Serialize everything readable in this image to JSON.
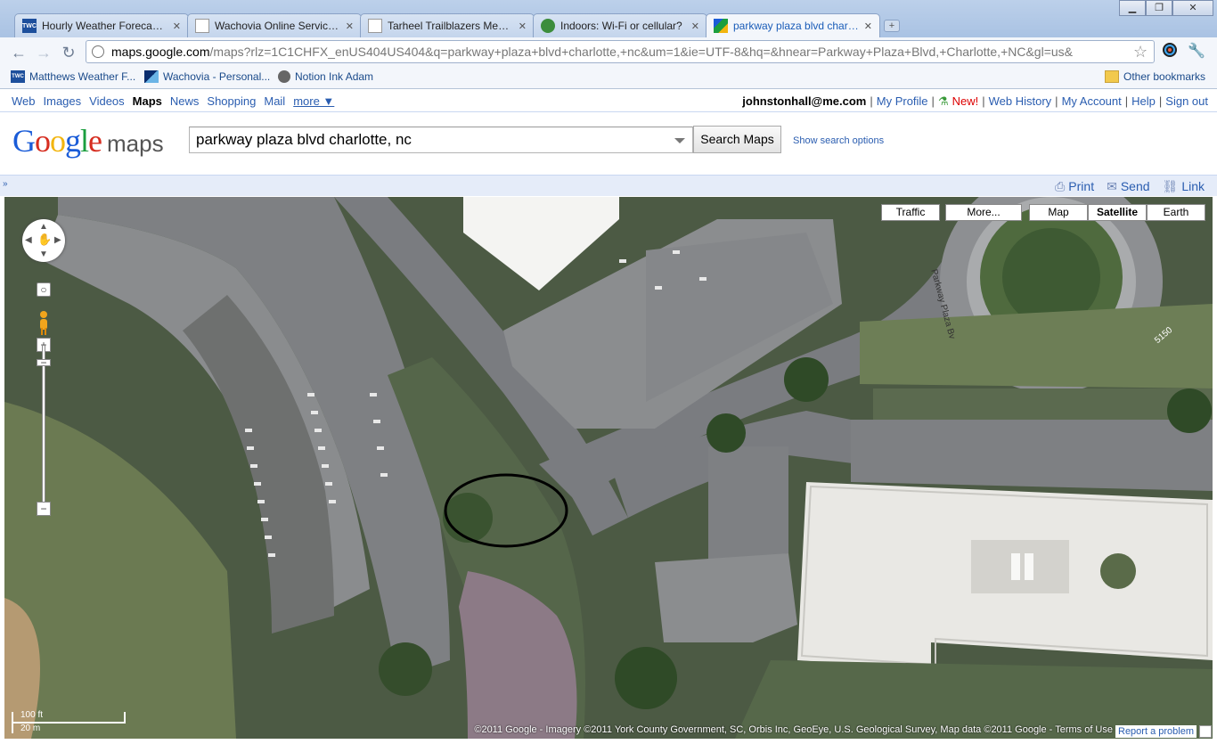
{
  "tabs": [
    {
      "label": "Hourly Weather Forecast ...",
      "icon": "twc-icon",
      "icon_text": "TWC"
    },
    {
      "label": "Wachovia Online Service...",
      "icon": "page-icon"
    },
    {
      "label": "Tarheel Trailblazers Mess...",
      "icon": "page-icon"
    },
    {
      "label": "Indoors: Wi-Fi or cellular?",
      "icon": "globe-icon"
    },
    {
      "label": "parkway plaza blvd charl...",
      "icon": "google-maps-icon"
    }
  ],
  "window": {
    "minimize": "▁",
    "maximize": "❐",
    "close": "✕"
  },
  "omnibox": {
    "host": "maps.google.com",
    "rest": "/maps?rlz=1C1CHFX_enUS404US404&q=parkway+plaza+blvd+charlotte,+nc&um=1&ie=UTF-8&hq=&hnear=Parkway+Plaza+Blvd,+Charlotte,+NC&gl=us&"
  },
  "bookmarks": [
    {
      "label": "Matthews Weather F...",
      "icon_text": "TWC"
    },
    {
      "label": "Wachovia - Personal...",
      "icon_text": ""
    },
    {
      "label": "Notion Ink Adam",
      "icon_text": ""
    }
  ],
  "other_bookmarks": "Other bookmarks",
  "gbar": {
    "left": [
      "Web",
      "Images",
      "Videos",
      "Maps",
      "News",
      "Shopping",
      "Mail"
    ],
    "more": "more ▼",
    "email": "johnstonhall@me.com",
    "my_profile": "My Profile",
    "new": "New!",
    "web_history": "Web History",
    "my_account": "My Account",
    "help": "Help",
    "sign_out": "Sign out",
    "sep": "|"
  },
  "header": {
    "logo_letters": [
      "G",
      "o",
      "o",
      "g",
      "l",
      "e"
    ],
    "logo_maps": "maps",
    "query": "parkway plaza blvd charlotte, nc",
    "search_button": "Search Maps",
    "show_options": "Show search options"
  },
  "printbar": {
    "collapse": "»",
    "print": "Print",
    "send": "Send",
    "link": "Link"
  },
  "map": {
    "types": [
      "Traffic",
      "More...",
      "Map",
      "Satellite",
      "Earth"
    ],
    "selected_type": "Satellite",
    "road_label": "Parkway Plaza Bv",
    "number_label": "5150",
    "scale_ft": "100 ft",
    "scale_m": "20 m",
    "copyright": "©2011 Google - Imagery ©2011 York County Government, SC, Orbis Inc, GeoEye, U.S. Geological Survey, Map data ©2011 Google - Terms of Use",
    "report": "Report a problem"
  },
  "colors": {
    "logo": [
      "#1a5cd8",
      "#d62d20",
      "#f2b50f",
      "#1a5cd8",
      "#1b9e3e",
      "#d62d20"
    ],
    "link": "#2a5db0",
    "new_red": "#dd0000"
  }
}
